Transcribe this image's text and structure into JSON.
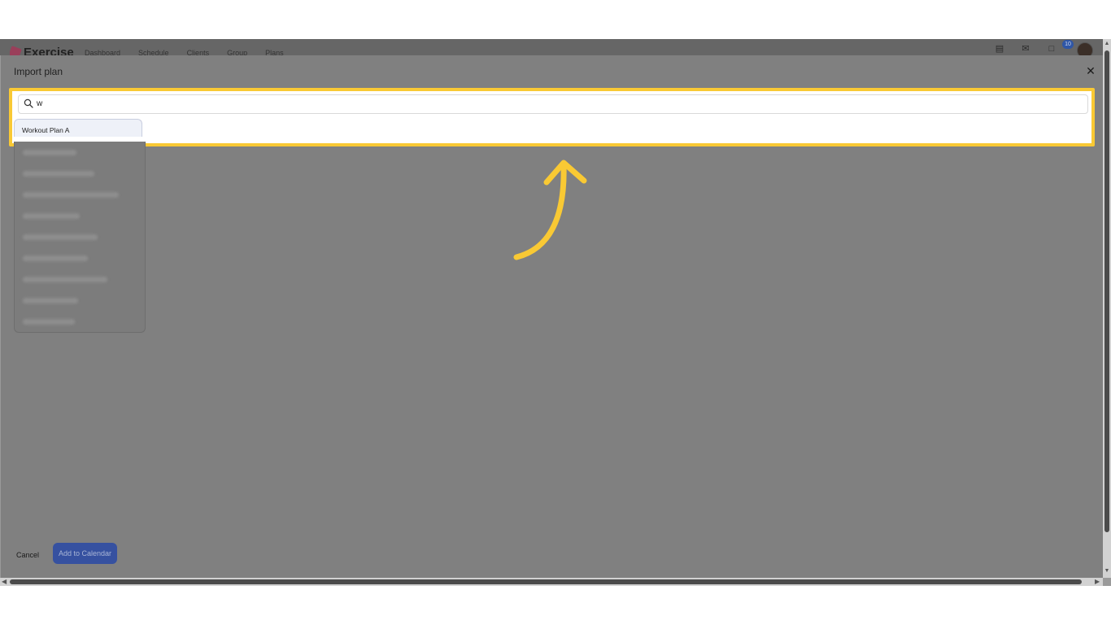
{
  "app": {
    "name": "Exercise",
    "nav": [
      "Dashboard",
      "Schedule",
      "Clients",
      "Group",
      "Plans"
    ],
    "notification_count": "10"
  },
  "modal": {
    "title": "Import plan",
    "search": {
      "value": "w",
      "placeholder": ""
    },
    "results": [
      "Workout Plan A"
    ],
    "footer": {
      "cancel_label": "Cancel",
      "add_label": "Add to Calendar"
    }
  },
  "colors": {
    "highlight": "#f9c934",
    "primary_button": "#3651a0",
    "overlay": "#808080"
  },
  "icons": [
    "search-icon",
    "close-icon",
    "bag-icon",
    "mail-icon",
    "bell-icon",
    "arrow-annotation-icon"
  ]
}
